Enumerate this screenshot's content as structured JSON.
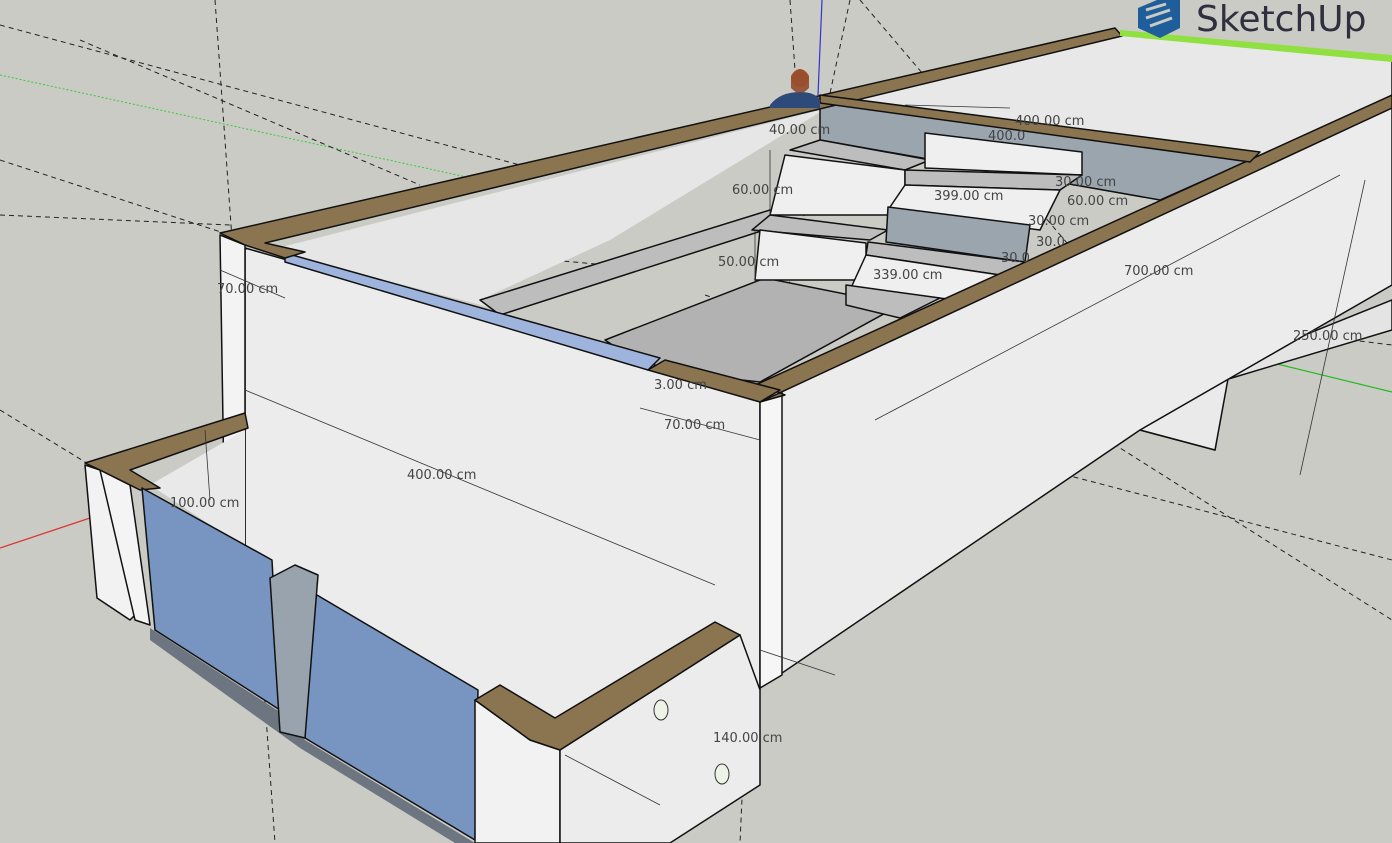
{
  "app": {
    "logo_text": "SketchUp",
    "brand_color": "#1f5e9a"
  },
  "colors": {
    "background": "#cbcbc6",
    "wall": "#ececec",
    "cap": "#8b7550",
    "glass": "#7894c0",
    "step_gray": "#9aa5ae"
  },
  "dimensions": [
    "400.00 cm",
    "400.0",
    "40.00 cm",
    "60.00 cm",
    "399.00 cm",
    "30.00 cm",
    "60.00 cm",
    "30.00 cm",
    "30.0",
    "30.0",
    "50.00 cm",
    "339.00 cm",
    "700.00 cm",
    "70.00 cm",
    "250.00 cm",
    "3.00 cm",
    "70.00 cm",
    "400.00 cm",
    "100.00 cm",
    "140.00 cm"
  ]
}
